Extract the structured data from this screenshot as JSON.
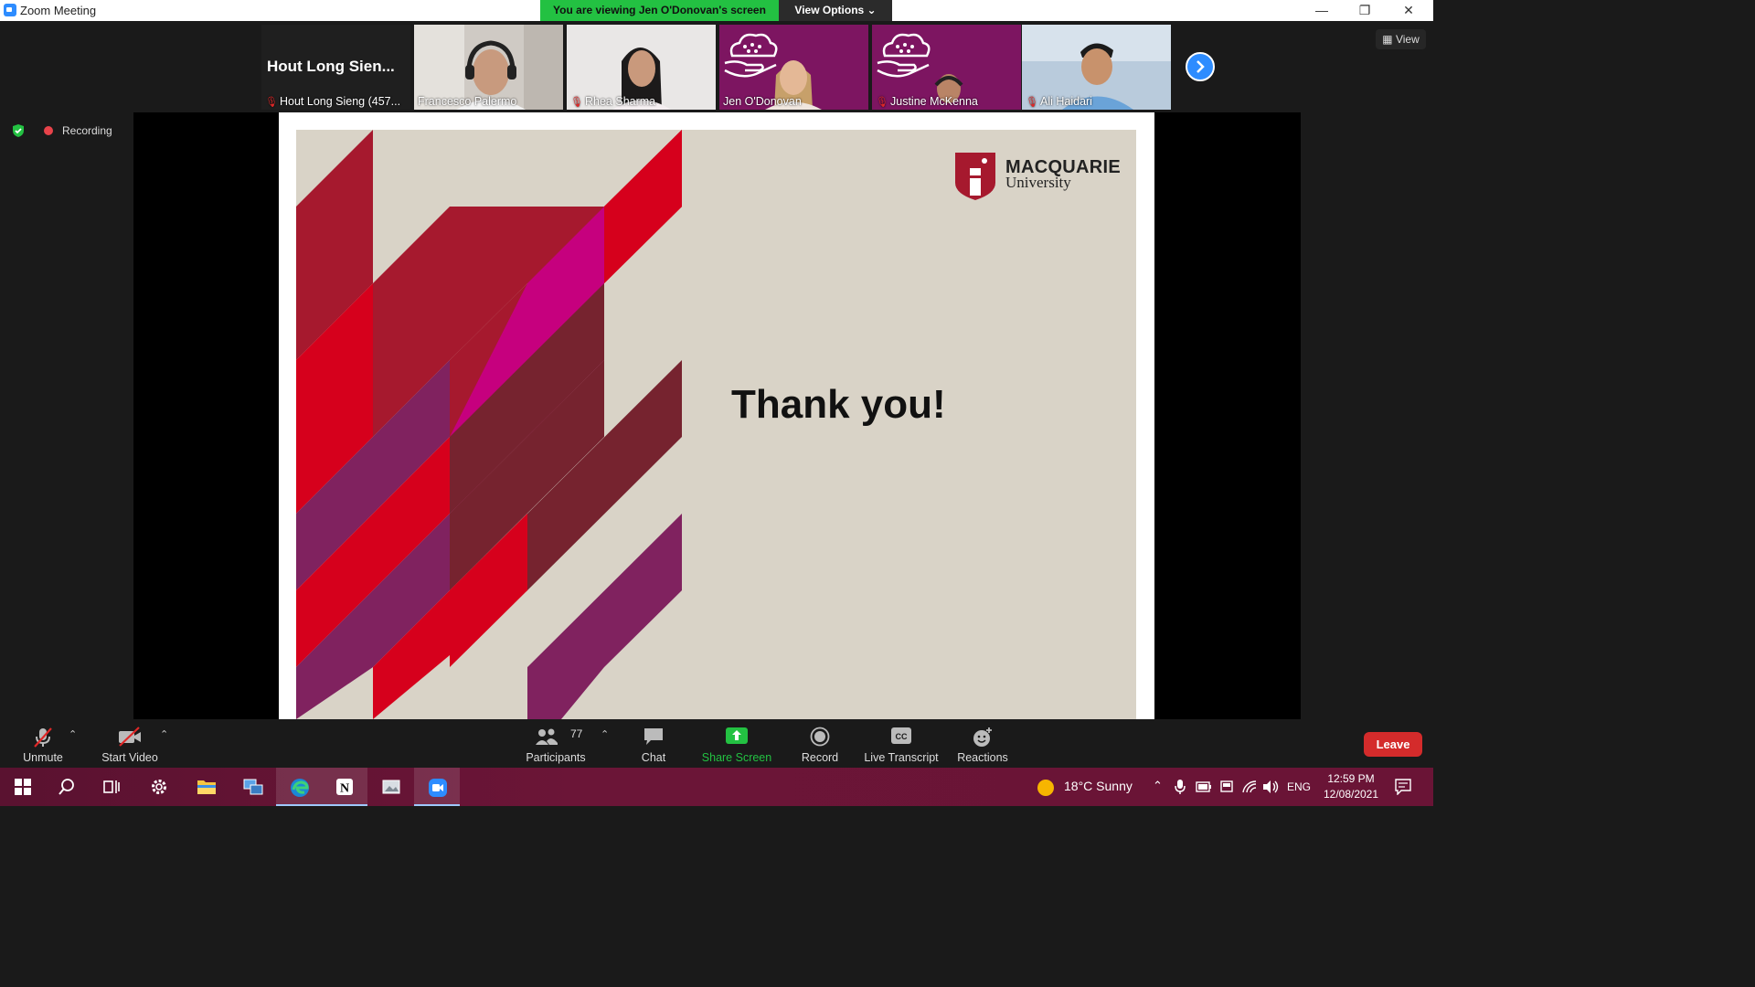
{
  "window": {
    "title": "Zoom Meeting"
  },
  "banner": {
    "viewing": "You are viewing Jen O'Donovan's screen",
    "view_options": "View Options ⌄"
  },
  "participants": [
    {
      "name": "Hout Long Sieng (457...",
      "big": "Hout Long Sien...",
      "muted": true
    },
    {
      "name": "Francesco Palermo",
      "muted": false
    },
    {
      "name": "Rhea Sharma",
      "muted": true
    },
    {
      "name": "Jen O'Donovan",
      "muted": false
    },
    {
      "name": "Justine McKenna",
      "muted": true
    },
    {
      "name": "Ali Haidari",
      "muted": true
    }
  ],
  "view_button": "View",
  "recording": {
    "label": "Recording"
  },
  "slide": {
    "logo_line1": "MACQUARIE",
    "logo_line2": "University",
    "text": "Thank you!"
  },
  "toolbar": {
    "unmute": "Unmute",
    "start_video": "Start Video",
    "participants_label": "Participants",
    "participants_count": "77",
    "chat": "Chat",
    "share_screen": "Share Screen",
    "record": "Record",
    "live_transcript": "Live Transcript",
    "reactions": "Reactions",
    "leave": "Leave"
  },
  "taskbar": {
    "weather": "18°C  Sunny",
    "language": "ENG",
    "time": "12:59 PM",
    "date": "12/08/2021"
  },
  "colors": {
    "share_green": "#23c142",
    "zoom_blue": "#2d8cff",
    "leave_red": "#d42b2b",
    "mq_red": "#a6192e",
    "mq_bright_red": "#d6001c",
    "mq_magenta": "#c6007e",
    "mq_purple": "#80225f",
    "mq_maroon": "#76232f",
    "slide_bg": "#d9d3c7"
  }
}
